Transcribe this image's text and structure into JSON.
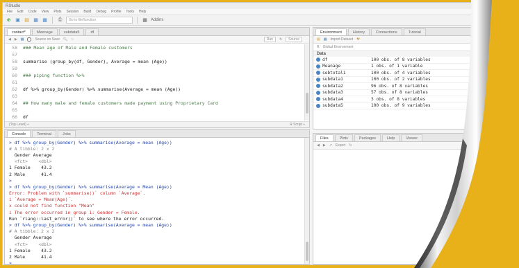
{
  "window": {
    "title": "RStudio"
  },
  "menu": [
    "File",
    "Edit",
    "Code",
    "View",
    "Plots",
    "Session",
    "Build",
    "Debug",
    "Profile",
    "Tools",
    "Help"
  ],
  "toolbar": {
    "goto_placeholder": "Go to file/function",
    "addins": "Addins"
  },
  "editor": {
    "tabs": [
      "contact*",
      "Meenage",
      "subdata5",
      "df"
    ],
    "source_on_save": "Source on Save",
    "run": "Run",
    "source": "Source",
    "lines": [
      {
        "n": "58",
        "text": "### Mean age of Male and Female customers",
        "cls": "cm"
      },
      {
        "n": "57",
        "text": "",
        "cls": "cd"
      },
      {
        "n": "58",
        "text": "summarise (group_by(df, Gender), Average = mean (Age))",
        "cls": "cd"
      },
      {
        "n": "59",
        "text": "",
        "cls": "cd"
      },
      {
        "n": "60",
        "text": "### piping function %>%",
        "cls": "cm"
      },
      {
        "n": "61",
        "text": "",
        "cls": "cd"
      },
      {
        "n": "62",
        "text": "df %>% group_by(Gender) %>% summarise(Average = mean (Age))",
        "cls": "cd"
      },
      {
        "n": "63",
        "text": "",
        "cls": "cd"
      },
      {
        "n": "64",
        "text": "## How many male and female customers made payment using Proprietary Card",
        "cls": "cm"
      },
      {
        "n": "65",
        "text": "",
        "cls": "cd"
      },
      {
        "n": "66",
        "text": "df",
        "cls": "cd"
      },
      {
        "n": "67",
        "text": "",
        "cls": "cd"
      },
      {
        "n": "68",
        "text": "",
        "cls": "cd"
      }
    ],
    "status_left": "(Top Level) ÷",
    "status_right": "R Script ÷"
  },
  "console": {
    "tabs": [
      "Console",
      "Terminal",
      "Jobs"
    ],
    "lines": [
      {
        "text": "> df %>% group_by(Gender) %>% summarise(Average = mean (Age))",
        "cls": "blue"
      },
      {
        "text": "# A tibble: 2 x 2",
        "cls": "muted"
      },
      {
        "text": "  Gender Average",
        "cls": "cd"
      },
      {
        "text": "  <fct>    <dbl>",
        "cls": "muted"
      },
      {
        "text": "1 Female    43.2",
        "cls": "cd"
      },
      {
        "text": "2 Male      41.4",
        "cls": "cd"
      },
      {
        "text": ">",
        "cls": "blue"
      },
      {
        "text": "> df %>% group_by(Gender) %>% summarise(Average = Mean (Age))",
        "cls": "blue"
      },
      {
        "text": "Error: Problem with `summarise()` column `Average`.",
        "cls": "red"
      },
      {
        "text": "i `Average = Mean(Age)`.",
        "cls": "red"
      },
      {
        "text": "x could not find function \"Mean\"",
        "cls": "red"
      },
      {
        "text": "i The error occurred in group 1: Gender = Female.",
        "cls": "red"
      },
      {
        "text": "Run `rlang::last_error()` to see where the error occurred.",
        "cls": "cd"
      },
      {
        "text": "> df %>% group_by(Gender) %>% summarise(Average = mean (Age))",
        "cls": "blue"
      },
      {
        "text": "# A tibble: 2 x 2",
        "cls": "muted"
      },
      {
        "text": "  Gender Average",
        "cls": "cd"
      },
      {
        "text": "  <fct>    <dbl>",
        "cls": "muted"
      },
      {
        "text": "1 Female    43.2",
        "cls": "cd"
      },
      {
        "text": "2 Male      41.4",
        "cls": "cd"
      },
      {
        "text": "> ",
        "cls": "blue"
      }
    ]
  },
  "environment": {
    "tabs": [
      "Environment",
      "History",
      "Connections",
      "Tutorial"
    ],
    "import": "Import Dataset",
    "scope": "R",
    "global": "Global Environment",
    "section": "Data",
    "rows": [
      {
        "name": "df",
        "value": "100 obs. of 8 variables"
      },
      {
        "name": "Meanage",
        "value": "1 obs. of 1 variable"
      },
      {
        "name": "sebtotal1",
        "value": "100 obs. of 4 variables"
      },
      {
        "name": "subdata1",
        "value": "100 obs. of 2 variables"
      },
      {
        "name": "subdata2",
        "value": "96 obs. of 8 variables"
      },
      {
        "name": "subdata3",
        "value": "57 obs. of 8 variables"
      },
      {
        "name": "subdata4",
        "value": "3 obs. of 8 variables"
      },
      {
        "name": "subdata5",
        "value": "100 obs. of 9 variables"
      }
    ]
  },
  "files": {
    "tabs": [
      "Files",
      "Plots",
      "Packages",
      "Help",
      "Viewer"
    ],
    "export": "Export"
  },
  "colors": {
    "background": "#e8b019",
    "accent": "#4a86c6",
    "error": "#cc3333"
  }
}
